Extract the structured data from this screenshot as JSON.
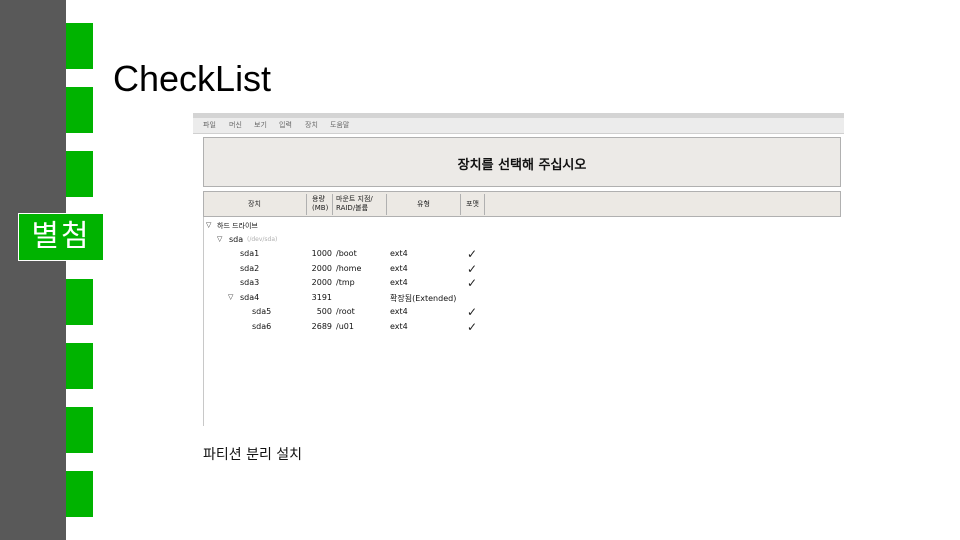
{
  "slide": {
    "title": "CheckList",
    "side_label": "별첨",
    "caption": "파티션 분리 설치",
    "accent_color": "#00b300",
    "sidebar_color": "#595959"
  },
  "installer": {
    "menu": [
      "파일",
      "머신",
      "보기",
      "입력",
      "장치",
      "도움말"
    ],
    "header_title": "장치를 선택해 주십시오",
    "columns": {
      "device": "장치",
      "size": [
        "용량",
        "(MB)"
      ],
      "mount": [
        "마운트 지점/",
        "RAID/볼륨"
      ],
      "type": "유형",
      "format": "포맷"
    },
    "tree": {
      "group_label": "하드 드라이브",
      "disk_label": "sda",
      "disk_path": "(/dev/sda)"
    },
    "rows": [
      {
        "device": "sda1",
        "size": "1000",
        "mount": "/boot",
        "type": "ext4",
        "format": "✓"
      },
      {
        "device": "sda2",
        "size": "2000",
        "mount": "/home",
        "type": "ext4",
        "format": "✓"
      },
      {
        "device": "sda3",
        "size": "2000",
        "mount": "/tmp",
        "type": "ext4",
        "format": "✓"
      },
      {
        "device": "sda4",
        "size": "3191",
        "mount": "",
        "type": "확장됨(Extended)",
        "format": ""
      },
      {
        "device": "sda5",
        "size": "500",
        "mount": "/root",
        "type": "ext4",
        "format": "✓"
      },
      {
        "device": "sda6",
        "size": "2689",
        "mount": "/u01",
        "type": "ext4",
        "format": "✓"
      }
    ]
  }
}
